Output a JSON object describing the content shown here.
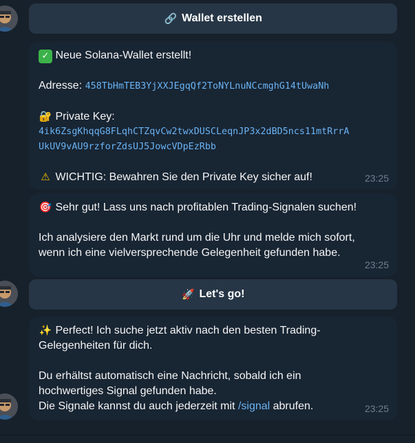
{
  "buttons": {
    "create_wallet": {
      "icon": "link-icon",
      "icon_glyph": "🔗",
      "label": "Wallet erstellen"
    },
    "lets_go": {
      "icon": "rocket-icon",
      "icon_glyph": "🚀",
      "label": "Let's go!"
    }
  },
  "messages": [
    {
      "heading_icon_glyph": "✓",
      "heading": "Neue Solana-Wallet erstellt!",
      "address_label": "Adresse:",
      "address": "458TbHmTEB3YjXXJEgqQf2ToNYLnuNCcmghG14tUwaNh",
      "private_key_icon_glyph": "🔐",
      "private_key_label": "Private Key:",
      "private_key_line1": "4ik6ZsgKhqqG8FLqhCTZqvCw2twxDUSCLeqnJP3x2dBD5ncs11mtRrrA",
      "private_key_line2": "UkUV9vAU9rzforZdsUJ5JowcVDpEzRbb",
      "warning_icon_glyph": "⚠",
      "warning": "WICHTIG: Bewahren Sie den Private Key sicher auf!",
      "time": "23:25"
    },
    {
      "icon_glyph": "🎯",
      "line1": "Sehr gut! Lass uns nach profitablen Trading-Signalen suchen!",
      "line2": "Ich analysiere den Markt rund um die Uhr und melde mich sofort,",
      "line3": "wenn ich eine vielversprechende Gelegenheit gefunden habe.",
      "time": "23:25"
    },
    {
      "icon_glyph": "✨",
      "line1": "Perfect! Ich suche jetzt aktiv nach den besten Trading-",
      "line2": "Gelegenheiten für dich.",
      "line3": "Du erhältst automatisch eine Nachricht, sobald ich ein",
      "line4": "hochwertiges Signal gefunden habe.",
      "line5_prefix": "Die Signale kannst du auch jederzeit mit ",
      "line5_link": "/signal",
      "line5_suffix": " abrufen.",
      "time": "23:25"
    }
  ],
  "colors": {
    "background": "#17212b",
    "bubble": "#182533",
    "button": "#263646",
    "link": "#6ab3f3",
    "timestamp": "#6d7f8f"
  }
}
